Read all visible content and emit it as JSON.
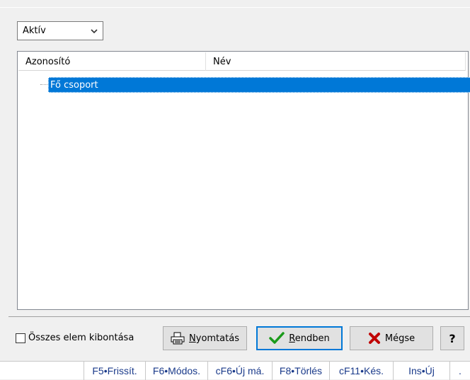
{
  "filter": {
    "selected": "Aktív"
  },
  "list": {
    "columns": [
      "Azonosító",
      "Név"
    ],
    "rows": [
      {
        "label": "Fő csoport",
        "selected": true
      }
    ]
  },
  "footer": {
    "expand_all_label": "Összes elem kibontása",
    "print_label_prefix": "",
    "print_mnemonic": "N",
    "print_label_rest": "yomtatás",
    "ok_mnemonic": "R",
    "ok_label_rest": "endben",
    "cancel_label": "Mégse",
    "help_label": "?"
  },
  "statusbar": {
    "items": [
      "F5•Frissít.",
      "F6•Módos.",
      "cF6•Új má.",
      "F8•Törlés",
      "cF11•Kés.",
      "Ins•Új",
      "."
    ]
  }
}
